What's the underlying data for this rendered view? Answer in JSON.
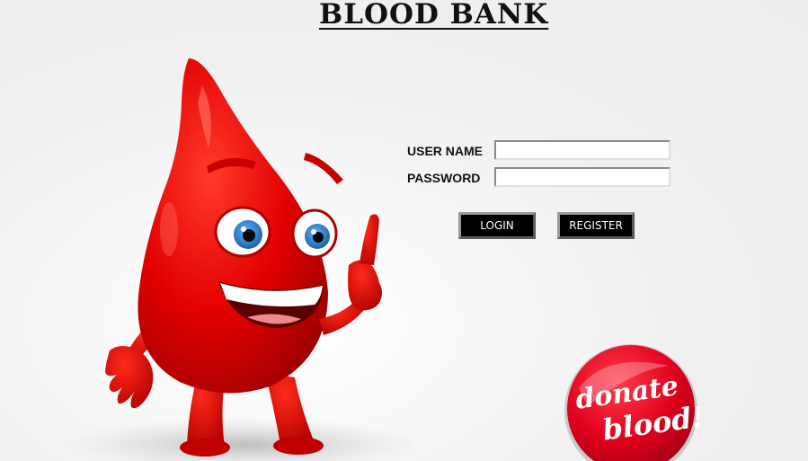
{
  "app": {
    "title": "BLOOD BANK"
  },
  "login_form": {
    "username_label": "USER NAME",
    "username_value": "",
    "password_label": "PASSWORD",
    "password_value": "",
    "login_button": "LOGIN",
    "register_button": "REGISTER"
  },
  "illustration": {
    "mascot": "blood-drop-mascot",
    "badge_line1": "donate",
    "badge_line2": "blood!"
  },
  "colors": {
    "background": "#f0efef",
    "drop_red": "#e00000",
    "button_bg": "#000000",
    "button_text": "#ffffff"
  }
}
